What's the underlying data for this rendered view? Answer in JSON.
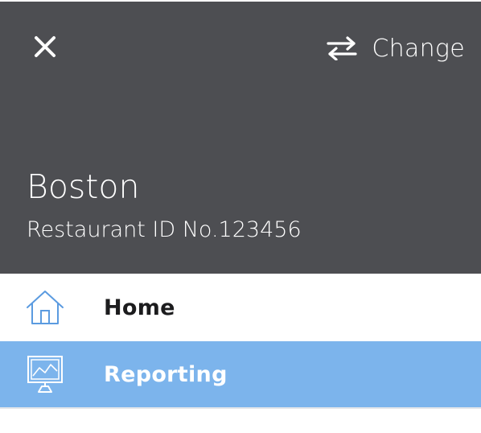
{
  "header": {
    "close_icon": "close-icon",
    "change_icon": "swap-arrows-icon",
    "change_label": "Change",
    "location_name": "Boston",
    "restaurant_id": "Restaurant ID No.123456",
    "background_color": "#4d4e52"
  },
  "nav": {
    "items": [
      {
        "label": "Home",
        "icon": "home-icon",
        "active": false
      },
      {
        "label": "Reporting",
        "icon": "reporting-monitor-icon",
        "active": true
      }
    ],
    "active_color": "#7cb4ec",
    "icon_color": "#5b9be0"
  }
}
